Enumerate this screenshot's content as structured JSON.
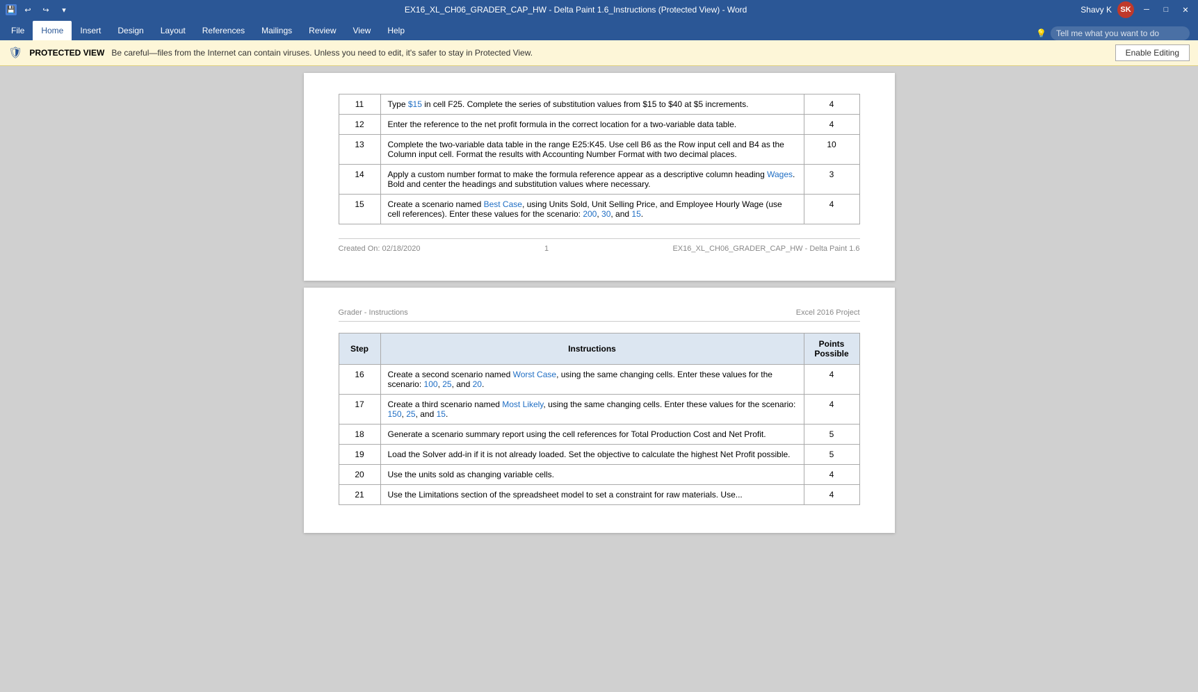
{
  "titlebar": {
    "title": "EX16_XL_CH06_GRADER_CAP_HW - Delta Paint 1.6_Instructions (Protected View)  -  Word",
    "app": "Word",
    "user": "Shavy K",
    "user_initials": "SK",
    "undo_label": "Undo",
    "redo_label": "Redo",
    "save_label": "Save"
  },
  "ribbon": {
    "tabs": [
      "File",
      "Home",
      "Insert",
      "Design",
      "Layout",
      "References",
      "Mailings",
      "Review",
      "View",
      "Help"
    ],
    "active_tab": "Home",
    "tell_me_placeholder": "Tell me what you want to do"
  },
  "protected_view": {
    "icon": "🛡",
    "label": "PROTECTED VIEW",
    "message": "Be careful—files from the Internet can contain viruses. Unless you need to edit, it's safer to stay in Protected View.",
    "button": "Enable Editing"
  },
  "page1": {
    "footer_left": "Created On: 02/18/2020",
    "footer_center": "1",
    "footer_right": "EX16_XL_CH06_GRADER_CAP_HW - Delta Paint 1.6",
    "rows": [
      {
        "step": "11",
        "instruction": "Type $15 in cell F25. Complete the series of substitution values from $15 to $40 at $5 increments.",
        "instruction_links": [
          {
            "text": "$15",
            "pos": 5
          }
        ],
        "points": "4"
      },
      {
        "step": "12",
        "instruction": "Enter the reference to the net profit formula in the correct location for a two-variable data table.",
        "instruction_links": [],
        "points": "4"
      },
      {
        "step": "13",
        "instruction": "Complete the two-variable data table in the range E25:K45. Use cell B6 as the Row input cell and B4 as the Column input cell. Format the results with Accounting Number Format with two decimal places.",
        "instruction_links": [],
        "points": "10"
      },
      {
        "step": "14",
        "instruction": "Apply a custom number format to make the formula reference appear as a descriptive column heading Wages. Bold and center the headings and substitution values where necessary.",
        "instruction_links": [
          {
            "text": "Wages",
            "pos": 1
          }
        ],
        "points": "3"
      },
      {
        "step": "15",
        "instruction": "Create a scenario named Best Case, using Units Sold, Unit Selling Price, and Employee Hourly Wage (use cell references). Enter these values for the scenario: 200, 30, and 15.",
        "instruction_links": [
          {
            "text": "Best Case",
            "pos": 1
          },
          {
            "text": "200",
            "pos": 2
          },
          {
            "text": "30",
            "pos": 3
          },
          {
            "text": "15",
            "pos": 4
          }
        ],
        "points": "4"
      }
    ]
  },
  "page2": {
    "header_left": "Grader - Instructions",
    "header_right": "Excel 2016 Project",
    "table_headers": [
      "Step",
      "Instructions",
      "Points\nPossible"
    ],
    "rows": [
      {
        "step": "16",
        "instruction": "Create a second scenario named Worst Case, using the same changing cells. Enter these values for the scenario: 100, 25, and 20.",
        "points": "4"
      },
      {
        "step": "17",
        "instruction": "Create a third scenario named Most Likely, using the same changing cells. Enter these values for the scenario: 150, 25, and 15.",
        "points": "4"
      },
      {
        "step": "18",
        "instruction": "Generate a scenario summary report using the cell references for Total Production Cost and Net Profit.",
        "points": "5"
      },
      {
        "step": "19",
        "instruction": "Load the Solver add-in if it is not already loaded. Set the objective to calculate the highest Net Profit possible.",
        "points": "5"
      },
      {
        "step": "20",
        "instruction": "Use the units sold as changing variable cells.",
        "points": "4"
      },
      {
        "step": "21",
        "instruction": "Use the Limitations section of the spreadsheet model to set a constraint for raw materials. Use...",
        "points": "4"
      }
    ]
  }
}
